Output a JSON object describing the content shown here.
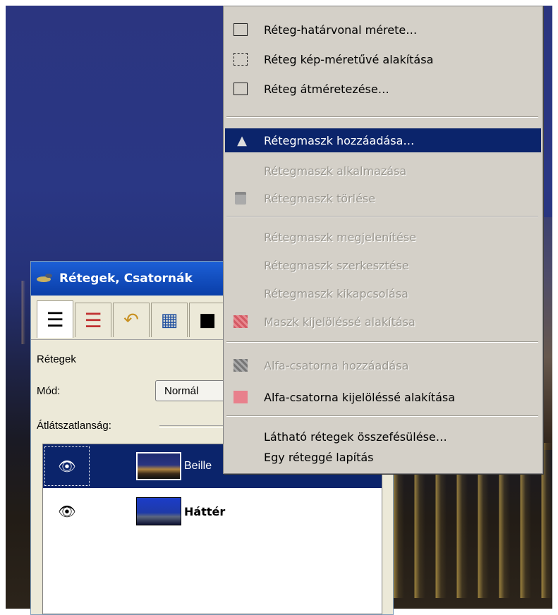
{
  "dialog": {
    "title": "Rétegek, Csatornák",
    "tabs": [
      {
        "icon": "layers-icon",
        "glyph": "☰"
      },
      {
        "icon": "channels-icon",
        "glyph": "☰"
      },
      {
        "icon": "undo-history-icon",
        "glyph": "↶"
      },
      {
        "icon": "histogram-icon",
        "glyph": "▦"
      },
      {
        "icon": "color-icon",
        "glyph": "■"
      }
    ],
    "section_label": "Rétegek",
    "mode_label": "Mód:",
    "mode_value": "Normál",
    "opacity_label": "Átlátszatlanság:",
    "layers": [
      {
        "name": "Beille",
        "selected": true
      },
      {
        "name": "Háttér",
        "selected": false
      }
    ]
  },
  "menu": {
    "items": [
      {
        "label": "Réteg-határvonal mérete…",
        "icon": "layer-boundary-icon",
        "disabled": false
      },
      {
        "label": "Réteg kép-méretűvé alakítása",
        "icon": "layer-to-image-size-icon",
        "disabled": false
      },
      {
        "label": "Réteg átméretezése…",
        "icon": "scale-layer-icon",
        "disabled": false
      },
      {
        "label": "Rétegmaszk hozzáadása…",
        "icon": "add-layer-mask-icon",
        "disabled": false,
        "highlight": true
      },
      {
        "label": "Rétegmaszk alkalmazása",
        "icon": "",
        "disabled": true
      },
      {
        "label": "Rétegmaszk törlése",
        "icon": "delete-mask-icon",
        "disabled": true
      },
      {
        "label": "Rétegmaszk megjelenítése",
        "icon": "",
        "disabled": true
      },
      {
        "label": "Rétegmaszk szerkesztése",
        "icon": "",
        "disabled": true
      },
      {
        "label": "Rétegmaszk kikapcsolása",
        "icon": "",
        "disabled": true
      },
      {
        "label": "Maszk kijelöléssé alakítása",
        "icon": "mask-to-selection-icon",
        "disabled": true
      },
      {
        "label": "Alfa-csatorna hozzáadása",
        "icon": "add-alpha-icon",
        "disabled": true
      },
      {
        "label": "Alfa-csatorna kijelöléssé alakítása",
        "icon": "alpha-to-selection-icon",
        "disabled": false
      },
      {
        "label": "Látható rétegek összefésülése…",
        "icon": "",
        "disabled": false
      },
      {
        "label": "Egy réteggé lapítás",
        "icon": "",
        "disabled": false
      }
    ]
  }
}
